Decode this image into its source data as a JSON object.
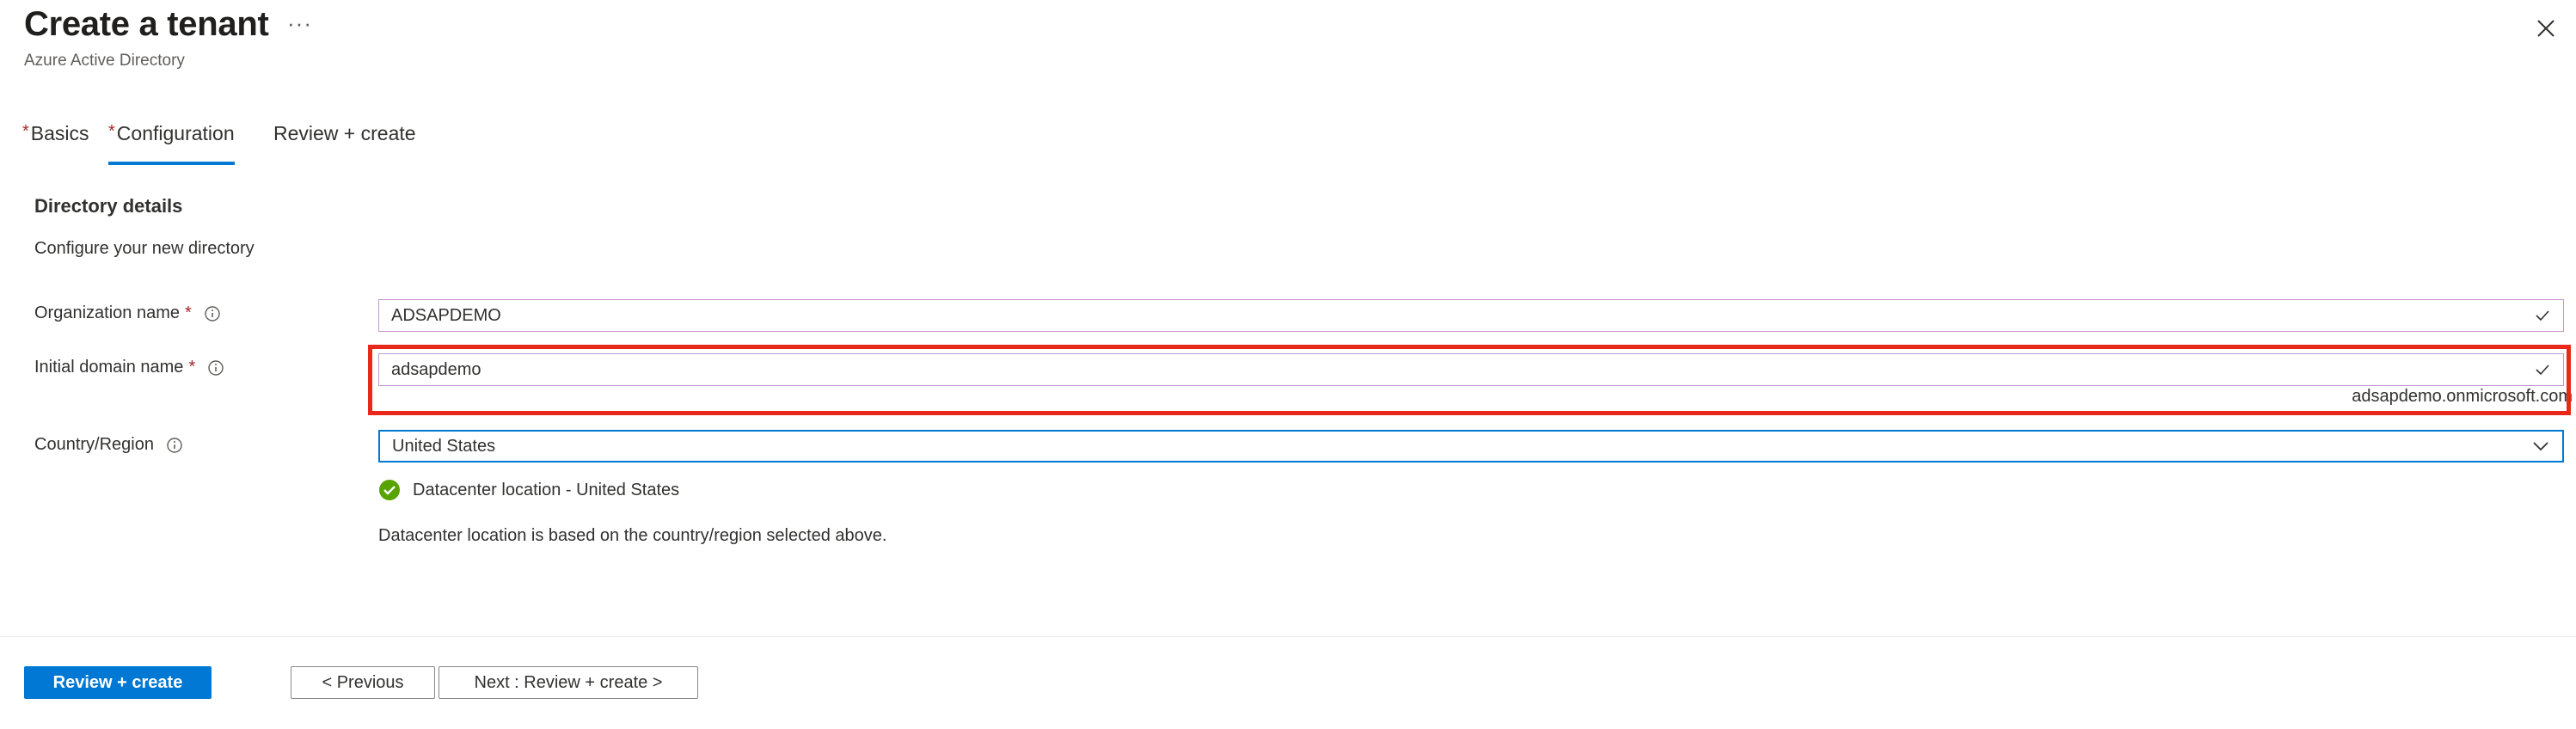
{
  "header": {
    "title": "Create a tenant",
    "more_label": "···",
    "subtitle": "Azure Active Directory"
  },
  "tabs": [
    {
      "label": "Basics",
      "required": "*"
    },
    {
      "label": "Configuration",
      "required": "*",
      "active": true
    },
    {
      "label": "Review + create",
      "required": ""
    }
  ],
  "section": {
    "title": "Directory details",
    "description": "Configure your new directory"
  },
  "form": {
    "org_name": {
      "label": "Organization name",
      "required": "*",
      "value": "ADSAPDEMO"
    },
    "domain_name": {
      "label": "Initial domain name",
      "required": "*",
      "value": "adsapdemo",
      "hint": "adsapdemo.onmicrosoft.com"
    },
    "country": {
      "label": "Country/Region",
      "value": "United States"
    }
  },
  "datacenter": {
    "status": "Datacenter location - United States",
    "note": "Datacenter location is based on the country/region selected above."
  },
  "footer": {
    "review_create": "Review + create",
    "previous": "< Previous",
    "next": "Next : Review + create >"
  },
  "colors": {
    "accent": "#0078d4",
    "required": "#a4262c",
    "success": "#57a300",
    "highlight": "#e8281b"
  },
  "icons": [
    "more-icon",
    "close-icon",
    "info-icon",
    "checkmark-icon",
    "chevron-down-icon",
    "success-check-icon"
  ]
}
